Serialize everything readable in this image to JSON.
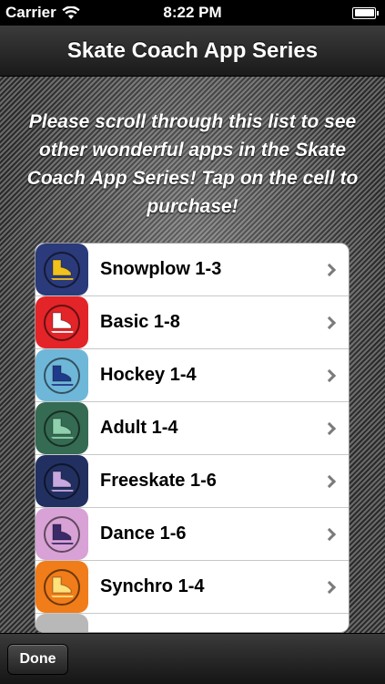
{
  "status_bar": {
    "carrier": "Carrier",
    "time": "8:22 PM",
    "battery_level": 1.0
  },
  "nav_bar": {
    "title": "Skate Coach App Series"
  },
  "intro_text": "Please scroll through this list to see other wonderful apps in the Skate Coach App Series! Tap on the cell to purchase!",
  "apps": [
    {
      "label": "Snowplow 1-3",
      "icon": "skate-icon",
      "icon_bg": "#2b3a7a",
      "skate_color": "#f2c21c"
    },
    {
      "label": "Basic 1-8",
      "icon": "skate-icon",
      "icon_bg": "#e32428",
      "skate_color": "#ffffff"
    },
    {
      "label": "Hockey 1-4",
      "icon": "skate-icon",
      "icon_bg": "#6fb7d8",
      "skate_color": "#1f3a8a"
    },
    {
      "label": "Adult 1-4",
      "icon": "skate-icon",
      "icon_bg": "#356b52",
      "skate_color": "#8fd0ae"
    },
    {
      "label": "Freeskate 1-6",
      "icon": "skate-icon",
      "icon_bg": "#223061",
      "skate_color": "#c9a8e0"
    },
    {
      "label": "Dance 1-6",
      "icon": "skate-icon",
      "icon_bg": "#d8a2d6",
      "skate_color": "#3a2a6a"
    },
    {
      "label": "Synchro 1-4",
      "icon": "skate-icon",
      "icon_bg": "#f07c1a",
      "skate_color": "#ffe07a"
    }
  ],
  "toolbar": {
    "done_label": "Done"
  }
}
